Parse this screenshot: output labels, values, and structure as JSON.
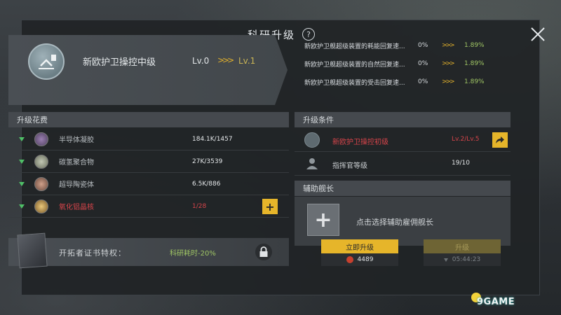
{
  "dialog": {
    "title": "科研升级",
    "help_label": "?"
  },
  "banner": {
    "name": "新欧护卫操控中级",
    "level_from": "Lv.0",
    "level_arrow": ">>>",
    "level_to": "Lv.1",
    "effects": [
      {
        "name": "新欧护卫舰超级装置的耗能回复速...",
        "from": "0%",
        "arrow": ">>>",
        "to": "1.89%"
      },
      {
        "name": "新欧护卫舰超级装置的自然回复速...",
        "from": "0%",
        "arrow": ">>>",
        "to": "1.89%"
      },
      {
        "name": "新欧护卫舰超级装置的受击回复速...",
        "from": "0%",
        "arrow": ">>>",
        "to": "1.89%"
      }
    ]
  },
  "cost": {
    "header": "升级花费",
    "items": [
      {
        "name": "半导体凝胶",
        "value": "184.1K/1457",
        "insufficient": false
      },
      {
        "name": "碳氢聚合物",
        "value": "27K/3539",
        "insufficient": false
      },
      {
        "name": "超导陶瓷体",
        "value": "6.5K/886",
        "insufficient": false
      },
      {
        "name": "氧化铝晶核",
        "value": "1/28",
        "insufficient": true
      }
    ],
    "add_label": "+"
  },
  "perk": {
    "label": "开拓者证书特权：",
    "value": "科研耗时-20%"
  },
  "conditions": {
    "header": "升级条件",
    "items": [
      {
        "name": "新欧护卫操控初级",
        "value": "Lv.2/Lv.5",
        "met": false
      },
      {
        "name": "指挥官等级",
        "value": "19/10",
        "met": true
      }
    ]
  },
  "assist": {
    "header": "辅助舰长",
    "add_label": "+",
    "text": "点击选择辅助雇佣舰长"
  },
  "actions": {
    "instant_label": "立即升级",
    "instant_cost": "4489",
    "upgrade_label": "升级",
    "upgrade_time": "05:44:23"
  },
  "watermark": "9GAME",
  "colors": {
    "accent": "#e6b52a",
    "warning": "#d6444a",
    "bonus": "#9fc564"
  }
}
